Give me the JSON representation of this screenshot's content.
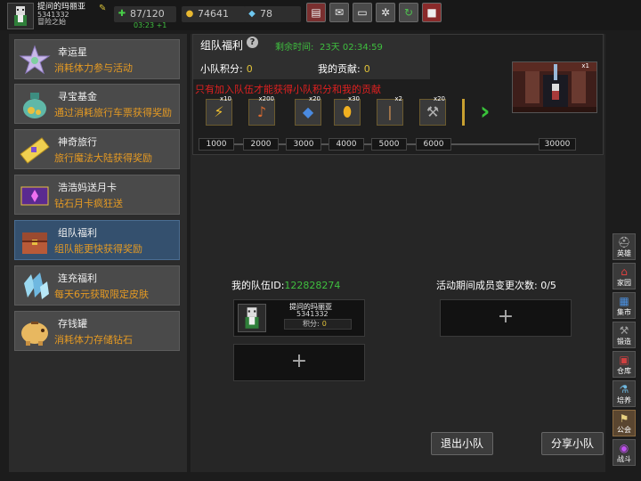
{
  "player": {
    "name": "提问的玛丽亚",
    "id": "5341332",
    "title": "冒险之始",
    "stamina": "87/120",
    "regen": "03:23 +1",
    "gold": "74641",
    "gems": "78"
  },
  "topbar": {
    "buttons": [
      "shop-icon",
      "mail-icon",
      "gamepad-icon",
      "settings-icon",
      "refresh-icon",
      "gift-icon"
    ]
  },
  "menu": {
    "items": [
      {
        "title": "幸运星",
        "subtitle": "消耗体力参与活动",
        "icon": "star-icon"
      },
      {
        "title": "寻宝基金",
        "subtitle": "通过消耗旅行车票获得奖励",
        "icon": "money-bag-icon"
      },
      {
        "title": "神奇旅行",
        "subtitle": "旅行魔法大陆获得奖励",
        "icon": "ticket-icon"
      },
      {
        "title": "浩浩妈送月卡",
        "subtitle": "钻石月卡疯狂送",
        "icon": "card-icon"
      },
      {
        "title": "组队福利",
        "subtitle": "组队能更快获得奖励",
        "icon": "chest-icon"
      },
      {
        "title": "连充福利",
        "subtitle": "每天6元获取限定皮肤",
        "icon": "crystal-icon"
      },
      {
        "title": "存钱罐",
        "subtitle": "消耗体力存储钻石",
        "icon": "piggy-bank-icon"
      }
    ]
  },
  "rewards": {
    "title": "组队福利",
    "remaining_label": "剩余时间:",
    "remaining_value": "23天 02:34:59",
    "team_points_label": "小队积分:",
    "team_points": "0",
    "my_contrib_label": "我的贡献:",
    "my_contrib": "0",
    "warning": "只有加入队伍才能获得小队积分和我的贡献",
    "items": [
      {
        "qty": "x10",
        "icon": "lightning-icon"
      },
      {
        "qty": "x200",
        "icon": "lute-icon"
      },
      {
        "qty": "x20",
        "icon": "gem-icon"
      },
      {
        "qty": "x30",
        "icon": "egg-icon"
      },
      {
        "qty": "x2",
        "icon": "scroll-icon"
      },
      {
        "qty": "x20",
        "icon": "hammer-icon"
      }
    ],
    "preview_qty": "x1",
    "milestones": [
      "1000",
      "2000",
      "3000",
      "4000",
      "5000",
      "6000",
      "30000"
    ]
  },
  "team": {
    "id_label": "我的队伍ID:",
    "id": "122828274",
    "change_label": "活动期间成员变更次数:",
    "change_count": "0/5",
    "member": {
      "name": "提问的玛丽亚",
      "id": "5341332",
      "points_label": "积分:",
      "points": "0"
    },
    "add_symbol": "+",
    "leave_label": "退出小队",
    "share_label": "分享小队"
  },
  "dock": {
    "items": [
      {
        "label": "英雄",
        "icon": "helmet-icon"
      },
      {
        "label": "家园",
        "icon": "house-icon"
      },
      {
        "label": "集市",
        "icon": "market-icon"
      },
      {
        "label": "锻造",
        "icon": "anvil-icon"
      },
      {
        "label": "仓库",
        "icon": "warehouse-icon"
      },
      {
        "label": "培养",
        "icon": "potion-icon"
      },
      {
        "label": "公会",
        "icon": "guild-icon"
      },
      {
        "label": "战斗",
        "icon": "portal-icon"
      }
    ]
  }
}
